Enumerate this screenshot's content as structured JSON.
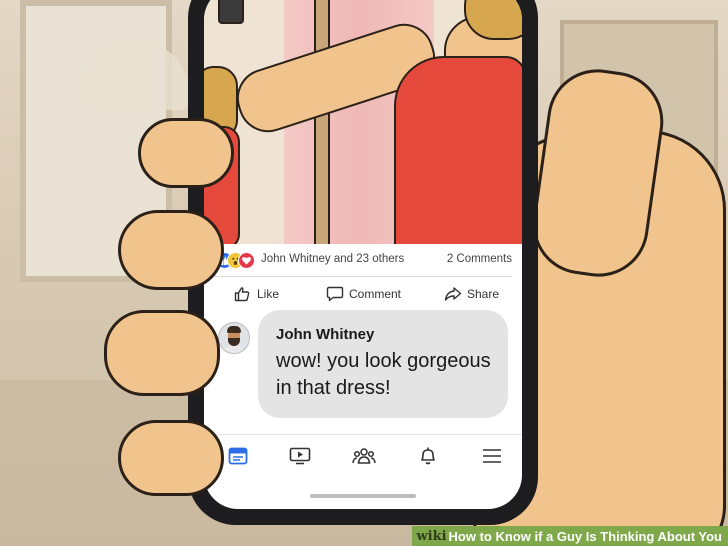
{
  "post": {
    "reactions_text": "John Whitney and 23 others",
    "comments_count": "2 Comments",
    "reaction_types": [
      "like",
      "wow",
      "love"
    ]
  },
  "actions": {
    "like_label": "Like",
    "comment_label": "Comment",
    "share_label": "Share"
  },
  "comment": {
    "author": "John Whitney",
    "text": "wow! you look gorgeous in that dress!"
  },
  "nav_icons": [
    "news-feed-icon",
    "watch-icon",
    "groups-icon",
    "notifications-icon",
    "menu-icon"
  ],
  "caption": {
    "brand": "wiki",
    "title": "How to Know if a Guy Is Thinking About You"
  },
  "colors": {
    "accent_blue": "#2d6ee8",
    "love_red": "#e7374a",
    "wow_yellow": "#f3c637",
    "dress_red": "#e5493c",
    "caption_green": "#7fa84a"
  }
}
